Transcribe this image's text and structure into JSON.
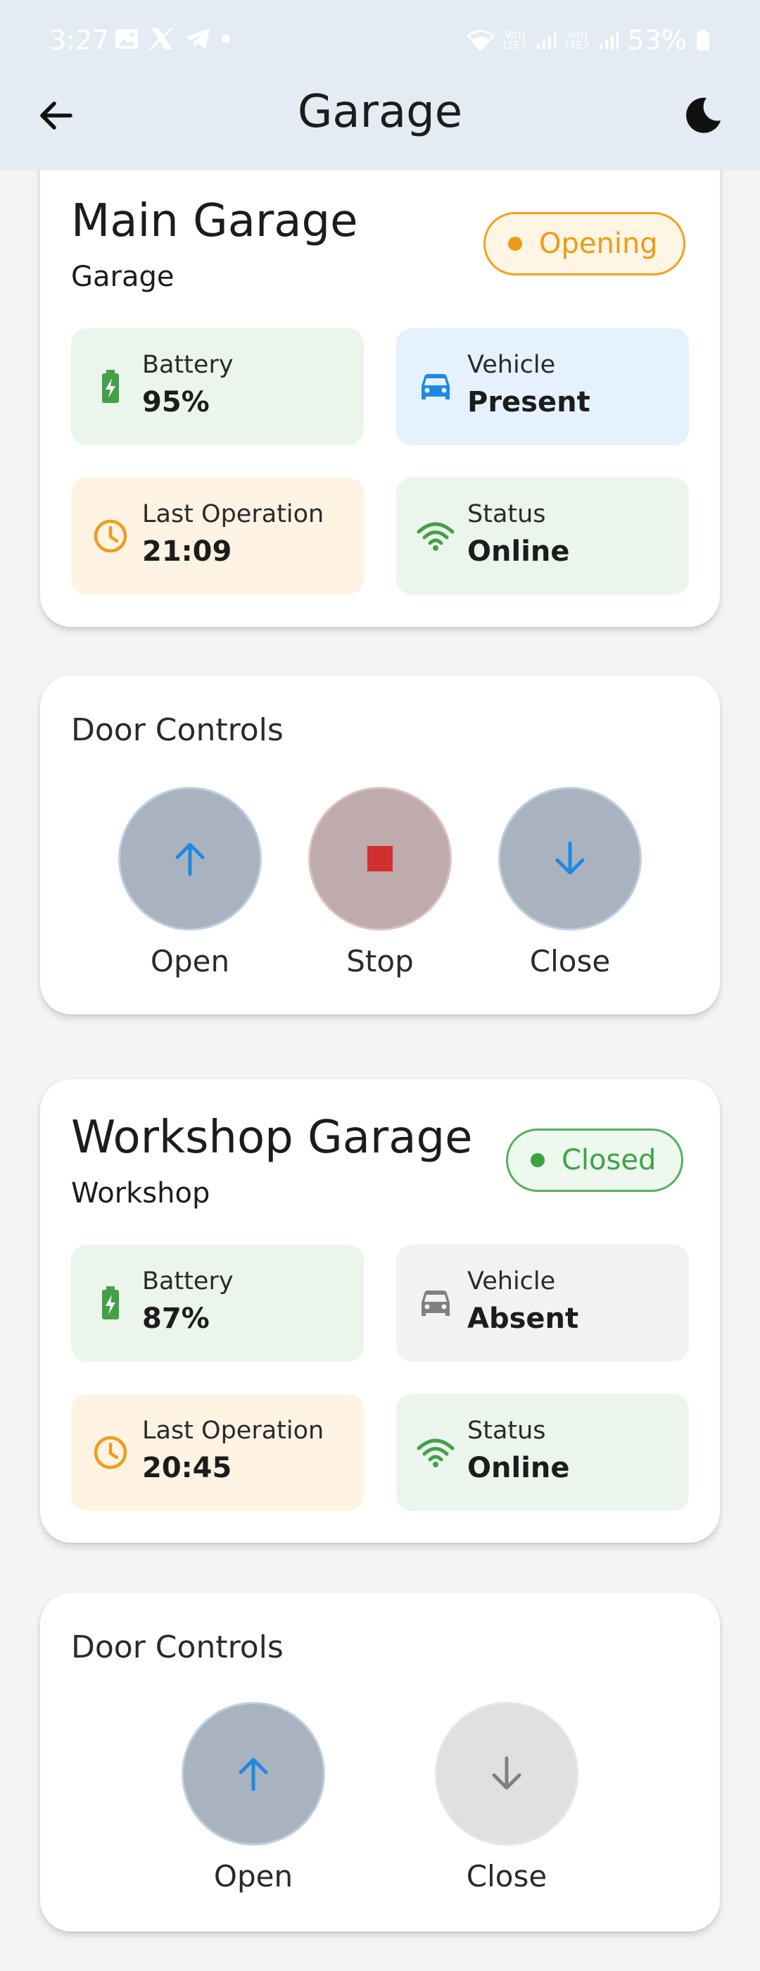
{
  "status_bar": {
    "time": "3:27",
    "carrier1_top": "Vo))",
    "carrier1_bottom": "LTE1",
    "carrier2_top": "Vo))",
    "carrier2_bottom": "LTE2",
    "battery": "53%"
  },
  "app_bar": {
    "title": "Garage"
  },
  "garages": [
    {
      "name": "Main Garage",
      "type": "Garage",
      "state": "Opening",
      "tiles": {
        "battery": {
          "label": "Battery",
          "value": "95%"
        },
        "vehicle": {
          "label": "Vehicle",
          "value": "Present"
        },
        "last_operation": {
          "label": "Last Operation",
          "value": "21:09"
        },
        "status": {
          "label": "Status",
          "value": "Online"
        }
      },
      "controls": {
        "title": "Door Controls",
        "open": "Open",
        "stop": "Stop",
        "close": "Close"
      }
    },
    {
      "name": "Workshop Garage",
      "type": "Workshop",
      "state": "Closed",
      "tiles": {
        "battery": {
          "label": "Battery",
          "value": "87%"
        },
        "vehicle": {
          "label": "Vehicle",
          "value": "Absent"
        },
        "last_operation": {
          "label": "Last Operation",
          "value": "20:45"
        },
        "status": {
          "label": "Status",
          "value": "Online"
        }
      },
      "controls": {
        "title": "Door Controls",
        "open": "Open",
        "close": "Close"
      }
    }
  ],
  "colors": {
    "green": "#43a047",
    "blue": "#1e88e5",
    "orange": "#f29b1c",
    "red": "#d32f2f",
    "grey": "#808080"
  }
}
